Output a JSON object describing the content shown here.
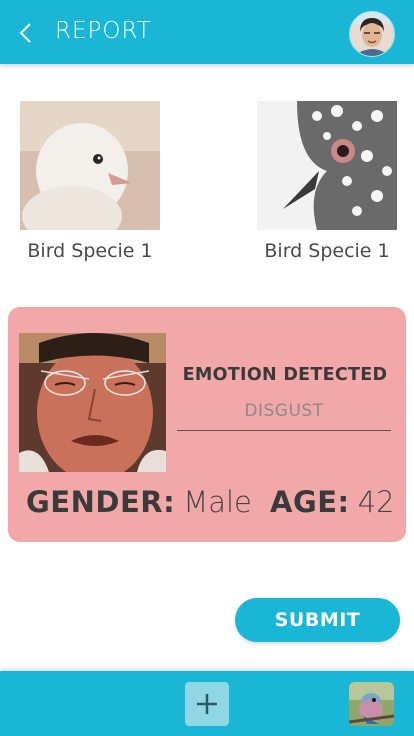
{
  "header": {
    "title": "REPORT",
    "back_icon": "chevron-left-icon",
    "avatar_icon": "user-avatar"
  },
  "birds": [
    {
      "label": "Bird Specie 1"
    },
    {
      "label": "Bird Specie 1"
    }
  ],
  "emotion": {
    "title": "EMOTION DETECTED",
    "value": "DISGUST",
    "gender_label": "GENDER:",
    "gender_value": "Male",
    "age_label": "AGE:",
    "age_value": "42"
  },
  "submit_label": "SUBMIT",
  "bottom_bar": {
    "add_icon": "plus-icon",
    "thumb_icon": "bird-thumbnail"
  },
  "colors": {
    "accent": "#1ab6d6",
    "card": "#f2a8a8"
  }
}
